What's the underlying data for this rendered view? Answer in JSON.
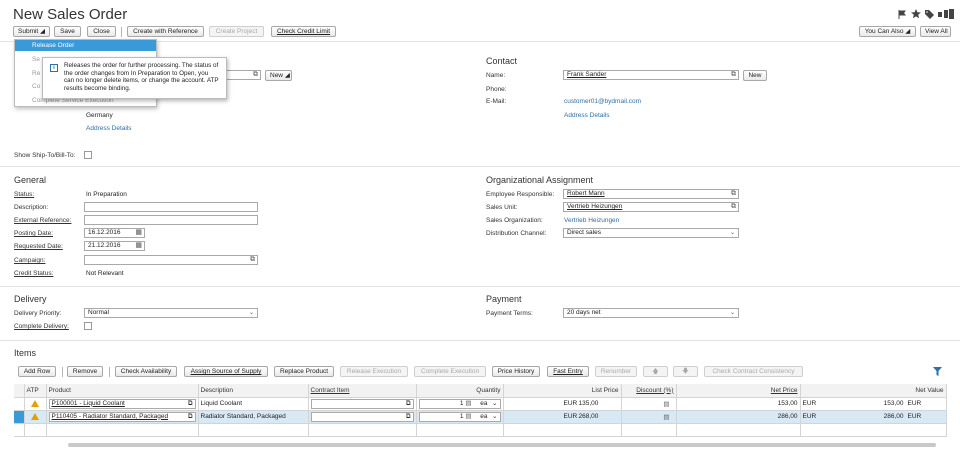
{
  "page": {
    "title": "New Sales Order"
  },
  "toolbar": {
    "submit": "Submit",
    "save": "Save",
    "close": "Close",
    "create_with_reference": "Create with Reference",
    "create_project": "Create Project",
    "check_credit_limit": "Check Credit Limit",
    "you_can_also": "You Can Also",
    "view_all": "View All"
  },
  "submit_menu": {
    "items": [
      "Release Order",
      "Se",
      "Re",
      "Co",
      "Complete Service Execution"
    ]
  },
  "tooltip": {
    "text": "Releases the order for further processing. The status of the order changes from In Preparation to Open, you can no longer delete items, or change the account. ATP results become binding."
  },
  "account": {
    "new_button": "New",
    "country": "Germany",
    "address_details": "Address Details"
  },
  "contact": {
    "heading": "Contact",
    "name_label": "Name:",
    "name_value": "Frank Sander",
    "new_button": "New",
    "phone_label": "Phone:",
    "email_label": "E-Mail:",
    "email_value": "customer01@bydmail.com",
    "address_details": "Address Details"
  },
  "ship_to": {
    "label": "Show Ship-To/Bill-To:"
  },
  "general": {
    "heading": "General",
    "status_label": "Status:",
    "status_value": "In Preparation",
    "description_label": "Description:",
    "external_ref_label": "External Reference:",
    "posting_date_label": "Posting Date:",
    "posting_date_value": "16.12.2016",
    "requested_date_label": "Requested Date:",
    "requested_date_value": "21.12.2016",
    "campaign_label": "Campaign:",
    "credit_status_label": "Credit Status:",
    "credit_status_value": "Not Relevant"
  },
  "org": {
    "heading": "Organizational Assignment",
    "employee_label": "Employee Responsible:",
    "employee_value": "Robert Mann",
    "sales_unit_label": "Sales Unit:",
    "sales_unit_value": "Vertrieb Heizungen",
    "sales_org_label": "Sales Organization:",
    "sales_org_value": "Vertrieb Heizungen",
    "dist_channel_label": "Distribution Channel:",
    "dist_channel_value": "Direct sales"
  },
  "delivery": {
    "heading": "Delivery",
    "priority_label": "Delivery Priority:",
    "priority_value": "Normal",
    "complete_label": "Complete Delivery:"
  },
  "payment": {
    "heading": "Payment",
    "terms_label": "Payment Terms:",
    "terms_value": "20 days net"
  },
  "items": {
    "heading": "Items",
    "buttons": {
      "add_row": "Add Row",
      "remove": "Remove",
      "check_availability": "Check Availability",
      "assign_source": "Assign Source of Supply",
      "replace_product": "Replace Product",
      "release_execution": "Release Execution",
      "complete_execution": "Complete Execution",
      "price_history": "Price History",
      "fast_entry": "Fast Entry",
      "renumber": "Renumber",
      "check_consistency": "Check Contract Consistency"
    },
    "columns": [
      "ATP",
      "Product",
      "Description",
      "Contract Item",
      "Quantity",
      "List Price",
      "Discount (%)",
      "Net Price",
      "Net Value"
    ],
    "rows": [
      {
        "product": "P100001 - Liquid Coolant",
        "description": "Liquid Coolant",
        "qty": "1",
        "unit": "ea",
        "list_price": "135,00",
        "list_cur": "EUR",
        "net_price": "153,00",
        "net_cur": "EUR",
        "net_value": "153,00",
        "value_cur": "EUR"
      },
      {
        "product": "P110405 - Radiator Standard, Packaged",
        "description": "Radiator Standard, Packaged",
        "qty": "1",
        "unit": "ea",
        "list_price": "268,00",
        "list_cur": "EUR",
        "net_price": "286,00",
        "net_cur": "EUR",
        "net_value": "286,00",
        "value_cur": "EUR"
      }
    ]
  }
}
